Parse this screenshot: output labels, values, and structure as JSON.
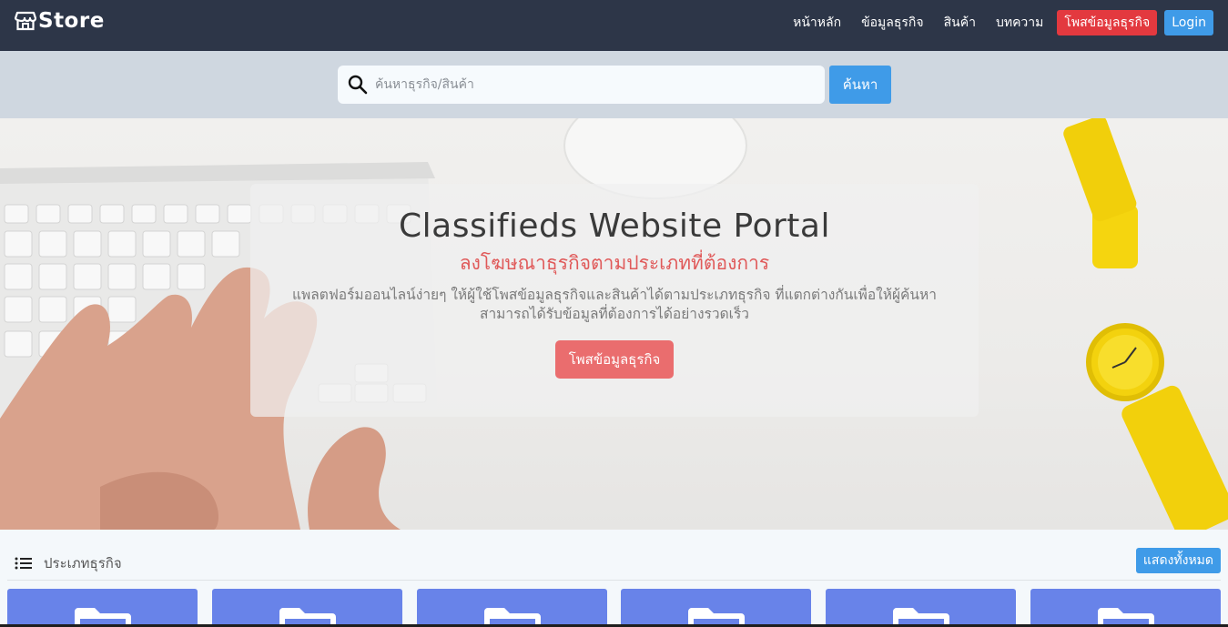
{
  "brand": {
    "name": "Store"
  },
  "nav": {
    "links": [
      "หน้าหลัก",
      "ข้อมูลธุรกิจ",
      "สินค้า",
      "บทความ"
    ],
    "post_label": "โพสข้อมูลธุรกิจ",
    "login_label": "Login"
  },
  "search": {
    "placeholder": "ค้นหาธุรกิจ/สินค้า",
    "button_label": "ค้นหา"
  },
  "hero": {
    "title": "Classifieds Website Portal",
    "subtitle": "ลงโฆษณาธุรกิจตามประเภทที่ต้องการ",
    "description": "แพลตฟอร์มออนไลน์ง่ายๆ ให้ผู้ใช้โพสข้อมูลธุรกิจและสินค้าได้ตามประเภทธุรกิจ ที่แตกต่างกันเพื่อให้ผู้ค้นหาสามารถได้รับข้อมูลที่ต้องการได้อย่างรวดเร็ว",
    "cta_label": "โพสข้อมูลธุรกิจ"
  },
  "categories": {
    "title": "ประเภทธุรกิจ",
    "show_all_label": "แสดงทั้งหมด",
    "card_count": 6
  },
  "colors": {
    "navbar": "#2d3648",
    "accent_red": "#e3393f",
    "accent_blue": "#3f9be8",
    "card_blue": "#6883e9",
    "hero_red_text": "#e05a5a"
  }
}
